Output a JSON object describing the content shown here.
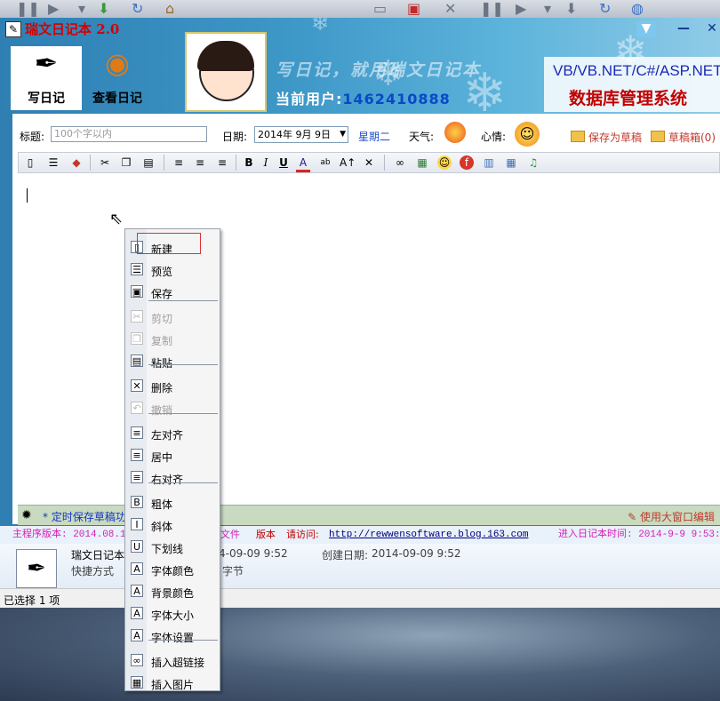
{
  "colors": {
    "accent": "#2f7fb3",
    "title_red": "#d40000",
    "link_blue": "#1a4dcb",
    "highlight_box": "#e03030"
  },
  "app": {
    "title": "瑞文日记本 2.0"
  },
  "banner": {
    "write_label": "写日记",
    "view_label": "查看日记",
    "slogan": "写日记，就用瑞文日记本",
    "user_prefix": "当前用户:",
    "user_value": "1462410888",
    "promo_line1": "VB/VB.NET/C#/ASP.NET",
    "promo_line2": "数据库管理系统"
  },
  "form": {
    "title_label": "标题:",
    "title_placeholder": "100个字以内",
    "date_label": "日期:",
    "date_value": "2014年 9月 9日",
    "weekday": "星期二",
    "weather_label": "天气:",
    "mood_label": "心情:",
    "save_draft": "保存为草稿",
    "drafts": "草稿箱(0)"
  },
  "toolbar_icons": [
    "new-doc-icon",
    "preview-icon",
    "eraser-icon",
    "cut-icon",
    "copy-icon",
    "paste-icon",
    "align-left-icon",
    "align-center-icon",
    "align-right-icon",
    "bold-icon",
    "italic-icon",
    "underline-icon",
    "font-color-icon",
    "highlight-icon",
    "font-size-icon",
    "tools-icon",
    "link-icon",
    "image-icon",
    "smiley-icon",
    "flash-icon",
    "table-icon",
    "grid-icon",
    "music-icon"
  ],
  "context_menu": [
    {
      "label": "新建",
      "icon": "new-doc-icon",
      "glyph": "▯",
      "enabled": true
    },
    {
      "label": "预览",
      "icon": "preview-icon",
      "glyph": "☰",
      "enabled": true
    },
    {
      "label": "保存",
      "icon": "save-icon",
      "glyph": "▣",
      "enabled": true
    },
    {
      "label": "剪切",
      "icon": "cut-icon",
      "glyph": "✂",
      "enabled": false
    },
    {
      "label": "复制",
      "icon": "copy-icon",
      "glyph": "❐",
      "enabled": false
    },
    {
      "label": "粘贴",
      "icon": "paste-icon",
      "glyph": "▤",
      "enabled": true
    },
    {
      "label": "删除",
      "icon": "delete-icon",
      "glyph": "✕",
      "enabled": true
    },
    {
      "label": "撤销",
      "icon": "undo-icon",
      "glyph": "↶",
      "enabled": false
    },
    {
      "label": "左对齐",
      "icon": "align-left-icon",
      "glyph": "≡",
      "enabled": true
    },
    {
      "label": "居中",
      "icon": "align-center-icon",
      "glyph": "≡",
      "enabled": true
    },
    {
      "label": "右对齐",
      "icon": "align-right-icon",
      "glyph": "≡",
      "enabled": true
    },
    {
      "label": "粗体",
      "icon": "bold-icon",
      "glyph": "B",
      "enabled": true
    },
    {
      "label": "斜体",
      "icon": "italic-icon",
      "glyph": "I",
      "enabled": true
    },
    {
      "label": "下划线",
      "icon": "underline-icon",
      "glyph": "U",
      "enabled": true
    },
    {
      "label": "字体颜色",
      "icon": "font-color-icon",
      "glyph": "A",
      "enabled": true
    },
    {
      "label": "背景颜色",
      "icon": "background-color-icon",
      "glyph": "A",
      "enabled": true
    },
    {
      "label": "字体大小",
      "icon": "font-size-icon",
      "glyph": "A",
      "enabled": true
    },
    {
      "label": "字体设置",
      "icon": "font-settings-icon",
      "glyph": "A",
      "enabled": true
    },
    {
      "label": "插入超链接",
      "icon": "link-icon",
      "glyph": "∞",
      "enabled": true
    },
    {
      "label": "插入图片",
      "icon": "image-icon",
      "glyph": "▦",
      "enabled": true
    }
  ],
  "editor_status": {
    "autosave": "* 定时保存草稿功",
    "big_window": "使用大窗口编辑"
  },
  "version_bar": {
    "main_version": "主程序版本: 2014.08.1",
    "file_version": "文件",
    "version_suffix": "版本",
    "visit_label": "请访问:",
    "url": "http://rewwensoftware.blog.163.com",
    "enter_time": "进入日记本时间: 2014-9-9 9:53:"
  },
  "details": {
    "name": "瑞文日记本",
    "type": "快捷方式",
    "modified": "4-09-09 9:52",
    "created_label": "创建日期:",
    "created_value": "2014-09-09 9:52",
    "size": "字节"
  },
  "selection_status": "已选择 1 项"
}
